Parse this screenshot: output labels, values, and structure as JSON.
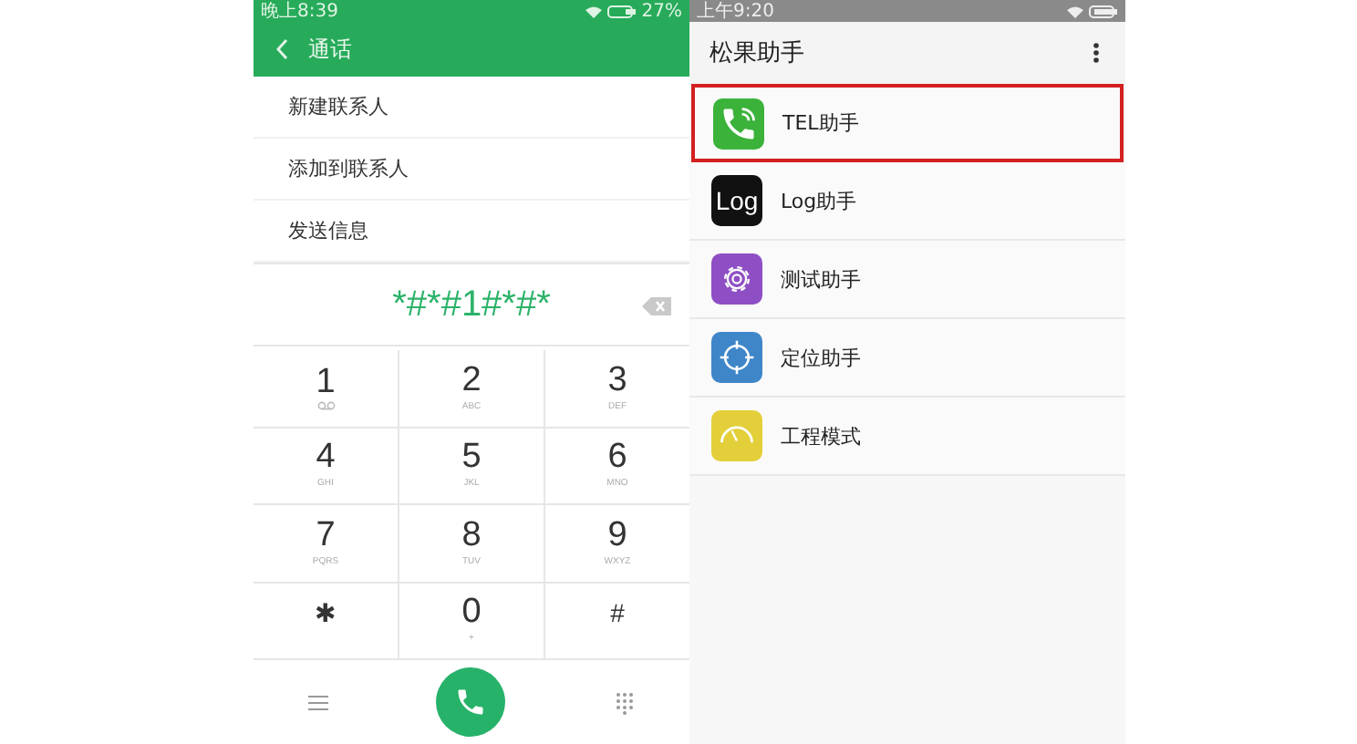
{
  "left_phone": {
    "status_bar": {
      "time": "晚上8:39",
      "battery": "27%"
    },
    "header": {
      "title": "通话"
    },
    "menu_items": [
      "新建联系人",
      "添加到联系人",
      "发送信息"
    ],
    "dialed_number": "*#*#1#*#*",
    "keys": [
      {
        "digit": "1",
        "kind": "voicemail"
      },
      {
        "digit": "2",
        "letters": "ABC",
        "kind": "letters"
      },
      {
        "digit": "3",
        "letters": "DEF",
        "kind": "letters"
      },
      {
        "digit": "4",
        "letters": "GHI",
        "kind": "letters"
      },
      {
        "digit": "5",
        "letters": "JKL",
        "kind": "letters"
      },
      {
        "digit": "6",
        "letters": "MNO",
        "kind": "letters"
      },
      {
        "digit": "7",
        "letters": "PQRS",
        "kind": "letters"
      },
      {
        "digit": "8",
        "letters": "TUV",
        "kind": "letters"
      },
      {
        "digit": "9",
        "letters": "WXYZ",
        "kind": "letters"
      },
      {
        "digit": "✱",
        "kind": "plain"
      },
      {
        "digit": "0",
        "letters": "+",
        "kind": "letters"
      },
      {
        "digit": "#",
        "kind": "plain"
      }
    ]
  },
  "right_phone": {
    "status_bar": {
      "time": "上午9:20"
    },
    "title": "松果助手",
    "apps": [
      {
        "name": "TEL助手",
        "kind": "phone",
        "selected": true
      },
      {
        "name": "Log助手",
        "kind": "log",
        "icon_text": "Log",
        "selected": false
      },
      {
        "name": "测试助手",
        "kind": "gear",
        "selected": false
      },
      {
        "name": "定位助手",
        "kind": "crosshair",
        "selected": false
      },
      {
        "name": "工程模式",
        "kind": "gauge",
        "selected": false
      }
    ]
  }
}
